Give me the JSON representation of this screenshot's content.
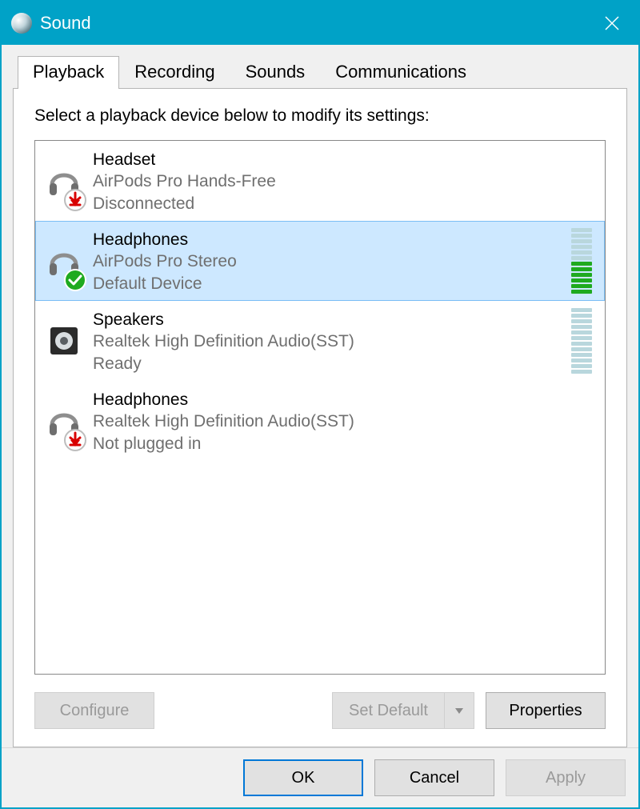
{
  "window": {
    "title": "Sound"
  },
  "tabs": [
    {
      "label": "Playback",
      "active": true
    },
    {
      "label": "Recording",
      "active": false
    },
    {
      "label": "Sounds",
      "active": false
    },
    {
      "label": "Communications",
      "active": false
    }
  ],
  "instruction": "Select a playback device below to modify its settings:",
  "devices": [
    {
      "title": "Headset",
      "detail": "AirPods Pro Hands-Free",
      "status": "Disconnected",
      "icon": "headset",
      "badge": "down-arrow",
      "selected": false,
      "meter": null
    },
    {
      "title": "Headphones",
      "detail": "AirPods Pro Stereo",
      "status": "Default Device",
      "icon": "headphones",
      "badge": "check",
      "selected": true,
      "meter": {
        "level": 6,
        "total": 12
      }
    },
    {
      "title": "Speakers",
      "detail": "Realtek High Definition Audio(SST)",
      "status": "Ready",
      "icon": "speaker",
      "badge": null,
      "selected": false,
      "meter": {
        "level": 0,
        "total": 12
      }
    },
    {
      "title": "Headphones",
      "detail": "Realtek High Definition Audio(SST)",
      "status": "Not plugged in",
      "icon": "headphones",
      "badge": "down-arrow",
      "selected": false,
      "meter": null
    }
  ],
  "panel_buttons": {
    "configure": "Configure",
    "set_default": "Set Default",
    "properties": "Properties"
  },
  "footer_buttons": {
    "ok": "OK",
    "cancel": "Cancel",
    "apply": "Apply"
  }
}
